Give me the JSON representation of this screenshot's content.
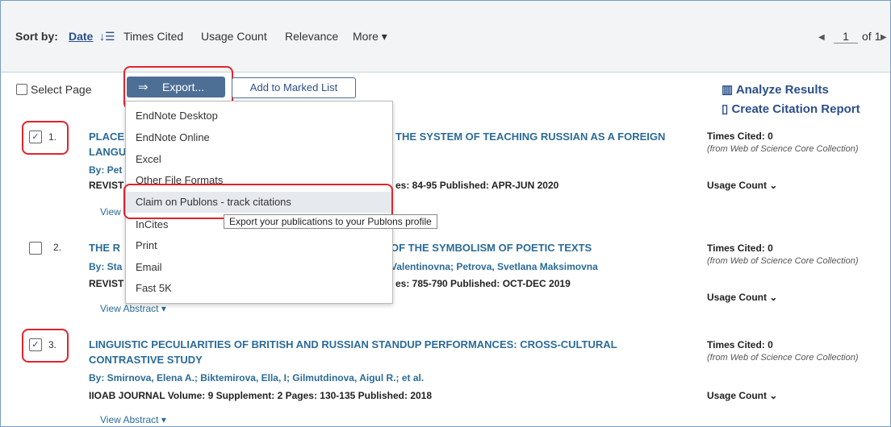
{
  "sortbar": {
    "label": "Sort by:",
    "date": "Date",
    "date_icon": "↓☰",
    "times_cited": "Times Cited",
    "usage_count": "Usage Count",
    "relevance": "Relevance",
    "more": "More ▾",
    "pagination": {
      "prev": "◀",
      "page": "1",
      "of": "of 1",
      "next": "▶"
    }
  },
  "toolbar": {
    "select_page": "Select Page",
    "export_label": "Export...",
    "export_icon": "⇒",
    "add_marked": "Add to Marked List"
  },
  "export_menu": {
    "items": [
      "EndNote Desktop",
      "EndNote Online",
      "Excel",
      "Other File Formats",
      "Claim on Publons - track citations",
      "InCites",
      "Print",
      "Email",
      "Fast 5K"
    ],
    "highlighted_index": 4,
    "tooltip": "Export your publications to your Publons profile"
  },
  "side": {
    "analyze": "Analyze Results",
    "analyze_icon": "▥",
    "cite_report": "Create Citation Report",
    "cite_icon": "▯"
  },
  "records": [
    {
      "num": "1.",
      "checked": true,
      "title_left": "PLACE",
      "title_left2": "LANGU",
      "title_right": "THE SYSTEM OF TEACHING RUSSIAN AS A FOREIGN",
      "authors_left": "By: Pet",
      "source_left": "REVIST",
      "source_right": "es: 84-95   Published:  APR-JUN 2020",
      "view_abstract": "View",
      "times_cited": "Times Cited: 0",
      "tc_note": "(from Web of Science Core Collection)",
      "usage": "Usage Count ⌄"
    },
    {
      "num": "2.",
      "checked": false,
      "title_left": "THE R",
      "title_right": "OF THE SYMBOLISM OF POETIC TEXTS",
      "authors_left": "By: Sta",
      "authors_right": "Valentinovna; Petrova, Svetlana Maksimovna",
      "source_left": "REVIST",
      "source_right": "es: 785-790   Published:  OCT-DEC 2019",
      "view_abstract": "View Abstract ▾",
      "times_cited": "Times Cited: 0",
      "tc_note": "(from Web of Science Core Collection)",
      "usage": "Usage Count ⌄"
    },
    {
      "num": "3.",
      "checked": true,
      "title": "LINGUISTIC PECULIARITIES OF BRITISH AND RUSSIAN STANDUP PERFORMANCES: CROSS-CULTURAL",
      "title2": "CONTRASTIVE STUDY",
      "authors": "By: Smirnova, Elena A.; Biktemirova, Ella, I; Gilmutdinova, Aigul R.; et al.",
      "source": "IIOAB JOURNAL  Volume: 9   Supplement: 2   Pages: 130-135   Published: 2018",
      "view_abstract": "View Abstract ▾",
      "times_cited": "Times Cited: 0",
      "tc_note": "(from Web of Science Core Collection)",
      "usage": "Usage Count ⌄"
    }
  ],
  "colors": {
    "accent": "#4d6f96",
    "link": "#2b6b98",
    "highlight_box": "#e0242d"
  }
}
